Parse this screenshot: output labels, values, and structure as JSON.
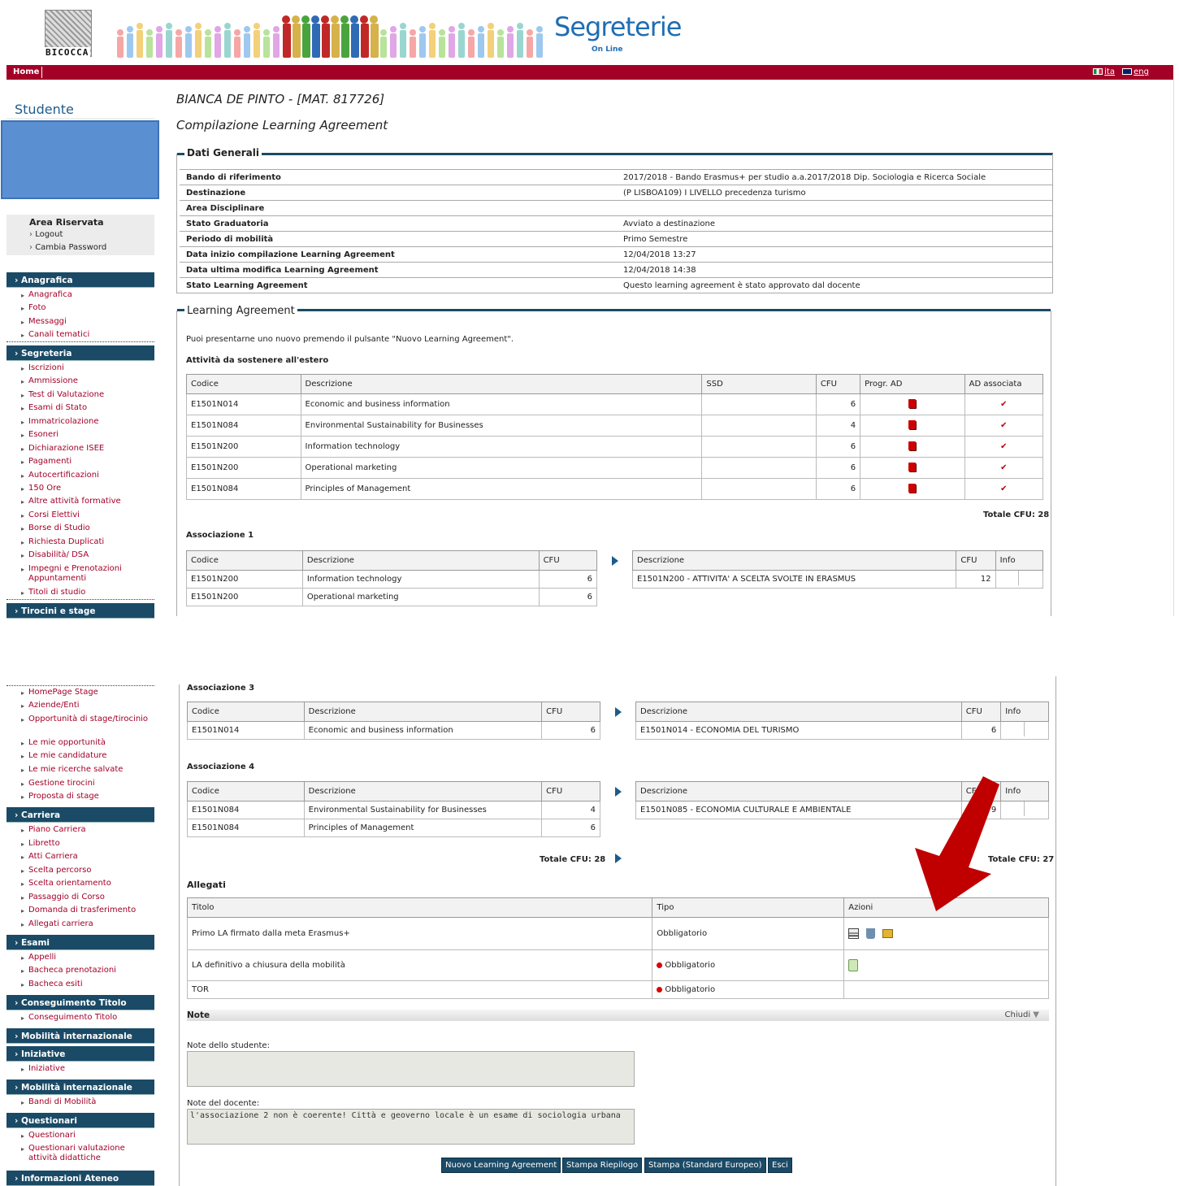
{
  "header": {
    "logo_text": "BICOCCA",
    "brand": "Segreterie",
    "brand_sub": "On Line",
    "home": "Home",
    "lang_ita": "ita",
    "lang_eng": "eng"
  },
  "sidebar": {
    "title": "Studente",
    "area_title": "Area Riservata",
    "logout": "Logout",
    "change_password": "Cambia Password",
    "sections": {
      "anagrafica": "Anagrafica",
      "segreteria": "Segreteria",
      "tirocini": "Tirocini e stage",
      "carriera": "Carriera",
      "esami": "Esami",
      "conseguimento": "Conseguimento Titolo",
      "mobilita1": "Mobilità internazionale",
      "iniziative": "Iniziative",
      "mobilita2": "Mobilità internazionale",
      "questionari": "Questionari",
      "info_ateneo": "Informazioni Ateneo"
    },
    "anagrafica_items": [
      "Anagrafica",
      "Foto",
      "Messaggi",
      "Canali tematici"
    ],
    "segreteria_items": [
      "Iscrizioni",
      "Ammissione",
      "Test di Valutazione",
      "Esami di Stato",
      "Immatricolazione",
      "Esoneri",
      "Dichiarazione ISEE",
      "Pagamenti",
      "Autocertificazioni",
      "150 Ore",
      "Altre attività formative",
      "Corsi Elettivi",
      "Borse di Studio",
      "Richiesta Duplicati",
      "Disabilità/ DSA",
      "Impegni e Prenotazioni Appuntamenti",
      "Titoli di studio"
    ],
    "tirocini_items": [
      "HomePage Stage",
      "Aziende/Enti",
      "Opportunità di stage/tirocinio",
      "Le mie opportunità",
      "Le mie candidature",
      "Le mie ricerche salvate",
      "Gestione tirocini",
      "Proposta di stage"
    ],
    "carriera_items": [
      "Piano Carriera",
      "Libretto",
      "Atti Carriera",
      "Scelta percorso",
      "Scelta orientamento",
      "Passaggio di Corso",
      "Domanda di trasferimento",
      "Allegati carriera"
    ],
    "esami_items": [
      "Appelli",
      "Bacheca prenotazioni",
      "Bacheca esiti"
    ],
    "conseguimento_items": [
      "Conseguimento Titolo"
    ],
    "iniziative_items": [
      "Iniziative"
    ],
    "mobilita2_items": [
      "Bandi di Mobilità"
    ],
    "questionari_items": [
      "Questionari",
      "Questionari valutazione attività didattiche"
    ]
  },
  "main": {
    "student_name": "BIANCA DE PINTO - [MAT. 817726]",
    "page_title": "Compilazione Learning Agreement",
    "dati_generali_title": "Dati Generali",
    "dati_generali": [
      {
        "k": "Bando di riferimento",
        "v": "2017/2018 - Bando Erasmus+ per studio a.a.2017/2018 Dip. Sociologia e Ricerca Sociale"
      },
      {
        "k": "Destinazione",
        "v": "(P LISBOA109) I LIVELLO precedenza turismo"
      },
      {
        "k": "Area Disciplinare",
        "v": ""
      },
      {
        "k": "Stato Graduatoria",
        "v": "Avviato a destinazione"
      },
      {
        "k": "Periodo di mobilità",
        "v": "Primo Semestre"
      },
      {
        "k": "Data inizio compilazione Learning Agreement",
        "v": "12/04/2018 13:27"
      },
      {
        "k": "Data ultima modifica Learning Agreement",
        "v": "12/04/2018 14:38"
      },
      {
        "k": "Stato Learning Agreement",
        "v": "Questo learning agreement è stato approvato dal docente"
      }
    ],
    "la_title": "Learning Agreement",
    "la_intro": "Puoi presentarne uno nuovo premendo il pulsante \"Nuovo Learning Agreement\".",
    "attivita_title": "Attività da sostenere all'estero",
    "attivita_headers": [
      "Codice",
      "Descrizione",
      "SSD",
      "CFU",
      "Progr. AD",
      "AD associata"
    ],
    "attivita_rows": [
      {
        "code": "E1501N014",
        "desc": "Economic and business information",
        "ssd": "",
        "cfu": "6",
        "check": "✔"
      },
      {
        "code": "E1501N084",
        "desc": "Environmental Sustainability for Businesses",
        "ssd": "",
        "cfu": "4",
        "check": "✔"
      },
      {
        "code": "E1501N200",
        "desc": "Information technology",
        "ssd": "",
        "cfu": "6",
        "check": "✔"
      },
      {
        "code": "E1501N200",
        "desc": "Operational marketing",
        "ssd": "",
        "cfu": "6",
        "check": "✔"
      },
      {
        "code": "E1501N084",
        "desc": "Principles of Management",
        "ssd": "",
        "cfu": "6",
        "check": "✔"
      }
    ],
    "totale_attivita": "Totale CFU: 28",
    "assoc_headers_left": [
      "Codice",
      "Descrizione",
      "CFU"
    ],
    "assoc_headers_right": [
      "Descrizione",
      "CFU",
      "Info"
    ],
    "assoc1": {
      "title": "Associazione 1",
      "left": [
        {
          "code": "E1501N200",
          "desc": "Information technology",
          "cfu": "6"
        },
        {
          "code": "E1501N200",
          "desc": "Operational marketing",
          "cfu": "6"
        }
      ],
      "right": {
        "desc": "E1501N200 - ATTIVITA' A SCELTA SVOLTE IN ERASMUS",
        "cfu": "12"
      }
    },
    "assoc3": {
      "title": "Associazione 3",
      "left": [
        {
          "code": "E1501N014",
          "desc": "Economic and business information",
          "cfu": "6"
        }
      ],
      "right": {
        "desc": "E1501N014 - ECONOMIA DEL TURISMO",
        "cfu": "6"
      }
    },
    "assoc4": {
      "title": "Associazione 4",
      "left": [
        {
          "code": "E1501N084",
          "desc": "Environmental Sustainability for Businesses",
          "cfu": "4"
        },
        {
          "code": "E1501N084",
          "desc": "Principles of Management",
          "cfu": "6"
        }
      ],
      "right": {
        "desc": "E1501N085 - ECONOMIA CULTURALE E AMBIENTALE",
        "cfu": "9"
      }
    },
    "totale_left": "Totale CFU: 28",
    "totale_right": "Totale CFU: 27",
    "allegati_title": "Allegati",
    "allegati_headers": [
      "Titolo",
      "Tipo",
      "Azioni"
    ],
    "allegati_rows": [
      {
        "title": "Primo LA firmato dalla meta Erasmus+",
        "type": "Obbligatorio"
      },
      {
        "title": "LA definitivo a chiusura della mobilità",
        "type": "Obbligatorio"
      },
      {
        "title": "TOR",
        "type": "Obbligatorio"
      }
    ],
    "note_title": "Note",
    "note_toggle": "Chiudi",
    "note_studente_label": "Note dello studente:",
    "note_studente_value": "",
    "note_docente_label": "Note del docente:",
    "note_docente_value": "l'associazione 2 non è coerente! Città e geoverno locale è un esame di sociologia urbana",
    "buttons": {
      "nuovo": "Nuovo Learning Agreement",
      "riepilogo": "Stampa Riepilogo",
      "europeo": "Stampa (Standard Europeo)",
      "esci": "Esci"
    }
  },
  "colors": {
    "brand_red": "#a30028",
    "nav_blue": "#1a4a66",
    "annotation_arrow": "#c00000"
  }
}
